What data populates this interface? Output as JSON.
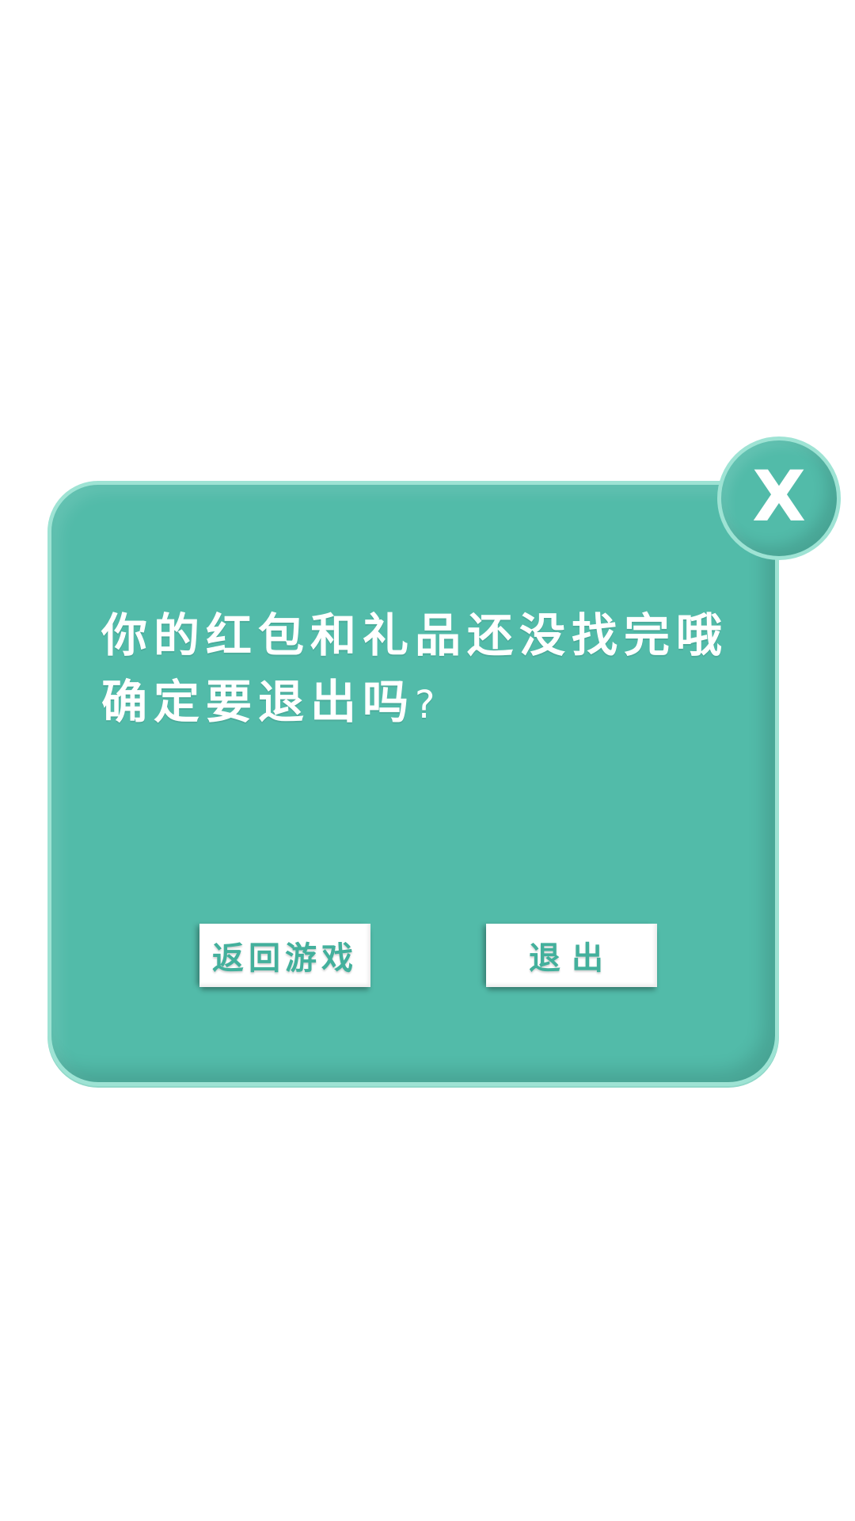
{
  "dialog": {
    "message_line1": "你的红包和礼品还没找完哦",
    "message_line2": "确定要退出吗",
    "question_mark": "?",
    "close_label": "X",
    "buttons": {
      "back_label": "返回游戏",
      "exit_label": "退出"
    }
  },
  "colors": {
    "panel": "#52bba9",
    "panel_border": "#9ee3d4",
    "button_bg": "#ffffff",
    "button_text": "#43b09c",
    "text": "#ffffff"
  },
  "icons": {
    "close": "close-icon"
  }
}
